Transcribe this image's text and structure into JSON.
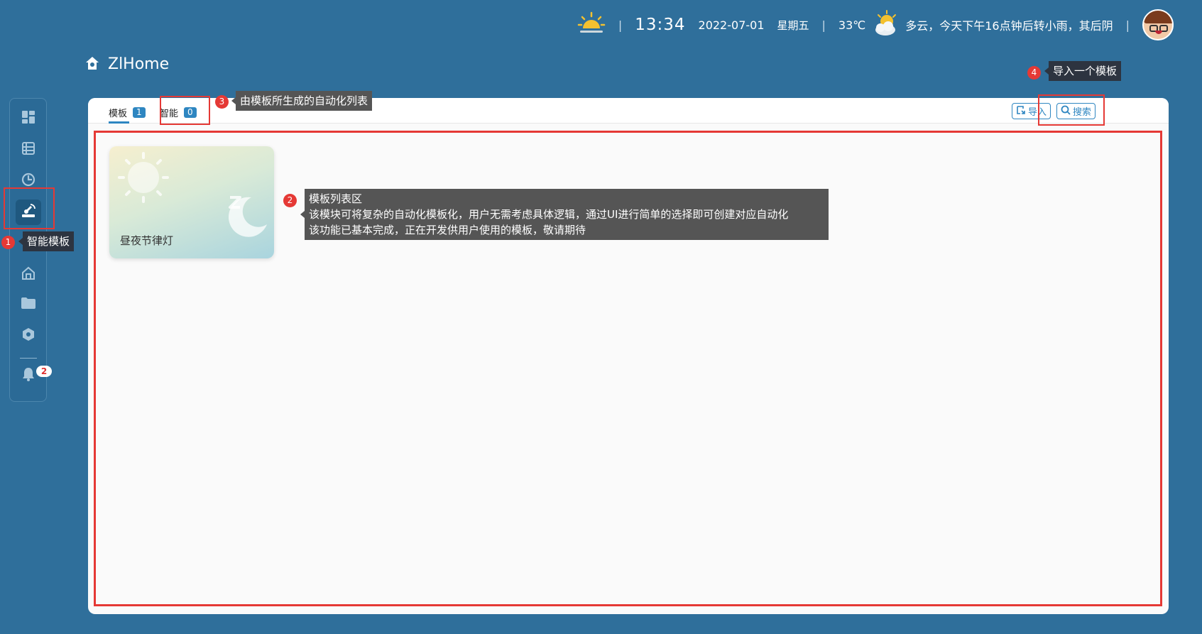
{
  "topbar": {
    "time": "13:34",
    "date": "2022-07-01",
    "weekday": "星期五",
    "temperature": "33℃",
    "forecast": "多云，今天下午16点钟后转小雨，其后阴",
    "separator": "|",
    "sunrise_icon": "sunrise-icon",
    "weather_icon": "partly-cloudy-icon"
  },
  "brand": {
    "title": "ZlHome",
    "icon": "home-icon"
  },
  "sidebar": {
    "items": [
      {
        "icon": "dashboard-icon"
      },
      {
        "icon": "list-icon"
      },
      {
        "icon": "history-icon"
      },
      {
        "icon": "template-icon",
        "active": true
      },
      {
        "icon": "house-icon"
      },
      {
        "icon": "folder-icon"
      },
      {
        "icon": "settings-hex-icon"
      },
      {
        "icon": "bell-icon"
      }
    ],
    "notification_count": "2"
  },
  "tabs": [
    {
      "label": "模板",
      "count": "1",
      "active": true
    },
    {
      "label": "智能",
      "count": "0",
      "active": false
    }
  ],
  "actions": {
    "import_label": "导入",
    "search_label": "搜索"
  },
  "templates": [
    {
      "name": "昼夜节律灯"
    }
  ],
  "annotations": {
    "n1": "1",
    "t1": "智能模板",
    "n2": "2",
    "t2_line1": "模板列表区",
    "t2_line2": "该模块可将复杂的自动化模板化，用户无需考虑具体逻辑，通过UI进行简单的选择即可创建对应自动化",
    "t2_line3": "该功能已基本完成，正在开发供用户使用的模板，敬请期待",
    "n3": "3",
    "t3": "由模板所生成的自动化列表",
    "n4": "4",
    "t4": "导入一个模板"
  },
  "colors": {
    "background": "#2f6f9b",
    "accent": "#2e86c1",
    "annotation": "#e53935"
  }
}
